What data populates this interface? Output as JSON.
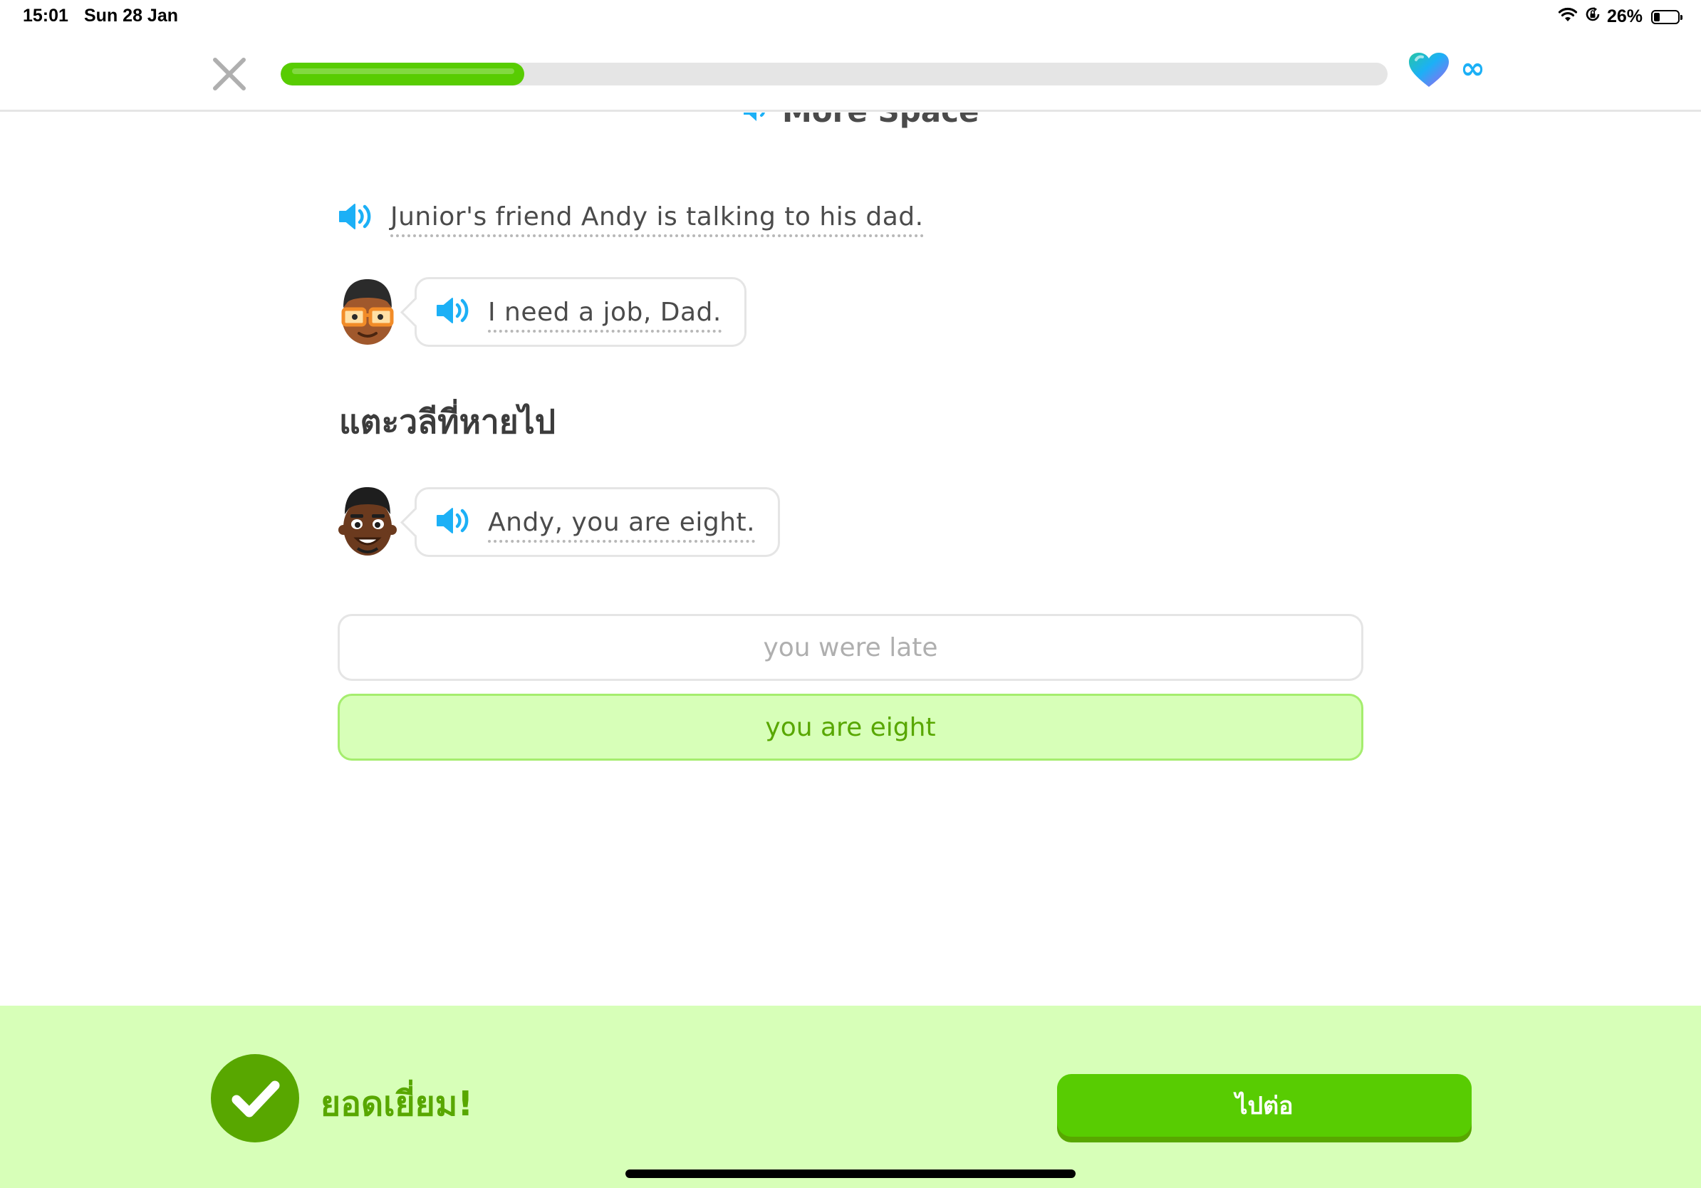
{
  "status_bar": {
    "time": "15:01",
    "date": "Sun 28 Jan",
    "battery_percent": "26%",
    "battery_level": 0.26,
    "icons": [
      "wifi-icon",
      "lock-rotation-icon",
      "battery-icon"
    ]
  },
  "lesson_header": {
    "progress": 0.22,
    "hearts_icon": "heart-icon",
    "hearts_value": "∞"
  },
  "story": {
    "title": "More Space",
    "narration": "Junior's friend Andy is talking to his dad.",
    "lines": [
      {
        "speaker": "andy",
        "text": "I need a job, Dad."
      },
      {
        "speaker": "dad",
        "text": "Andy, you are eight."
      }
    ],
    "instruction": "แตะวลีที่หายไป"
  },
  "options": [
    {
      "label": "you were late",
      "state": "disabled"
    },
    {
      "label": "you are eight",
      "state": "correct"
    }
  ],
  "feedback": {
    "title": "ยอดเยี่ยม!",
    "continue_label": "ไปต่อ"
  },
  "colors": {
    "brand_green": "#58cc02",
    "correct_bg": "#d7ffb8",
    "correct_text": "#58a700",
    "speaker_blue": "#1cb0f6"
  }
}
